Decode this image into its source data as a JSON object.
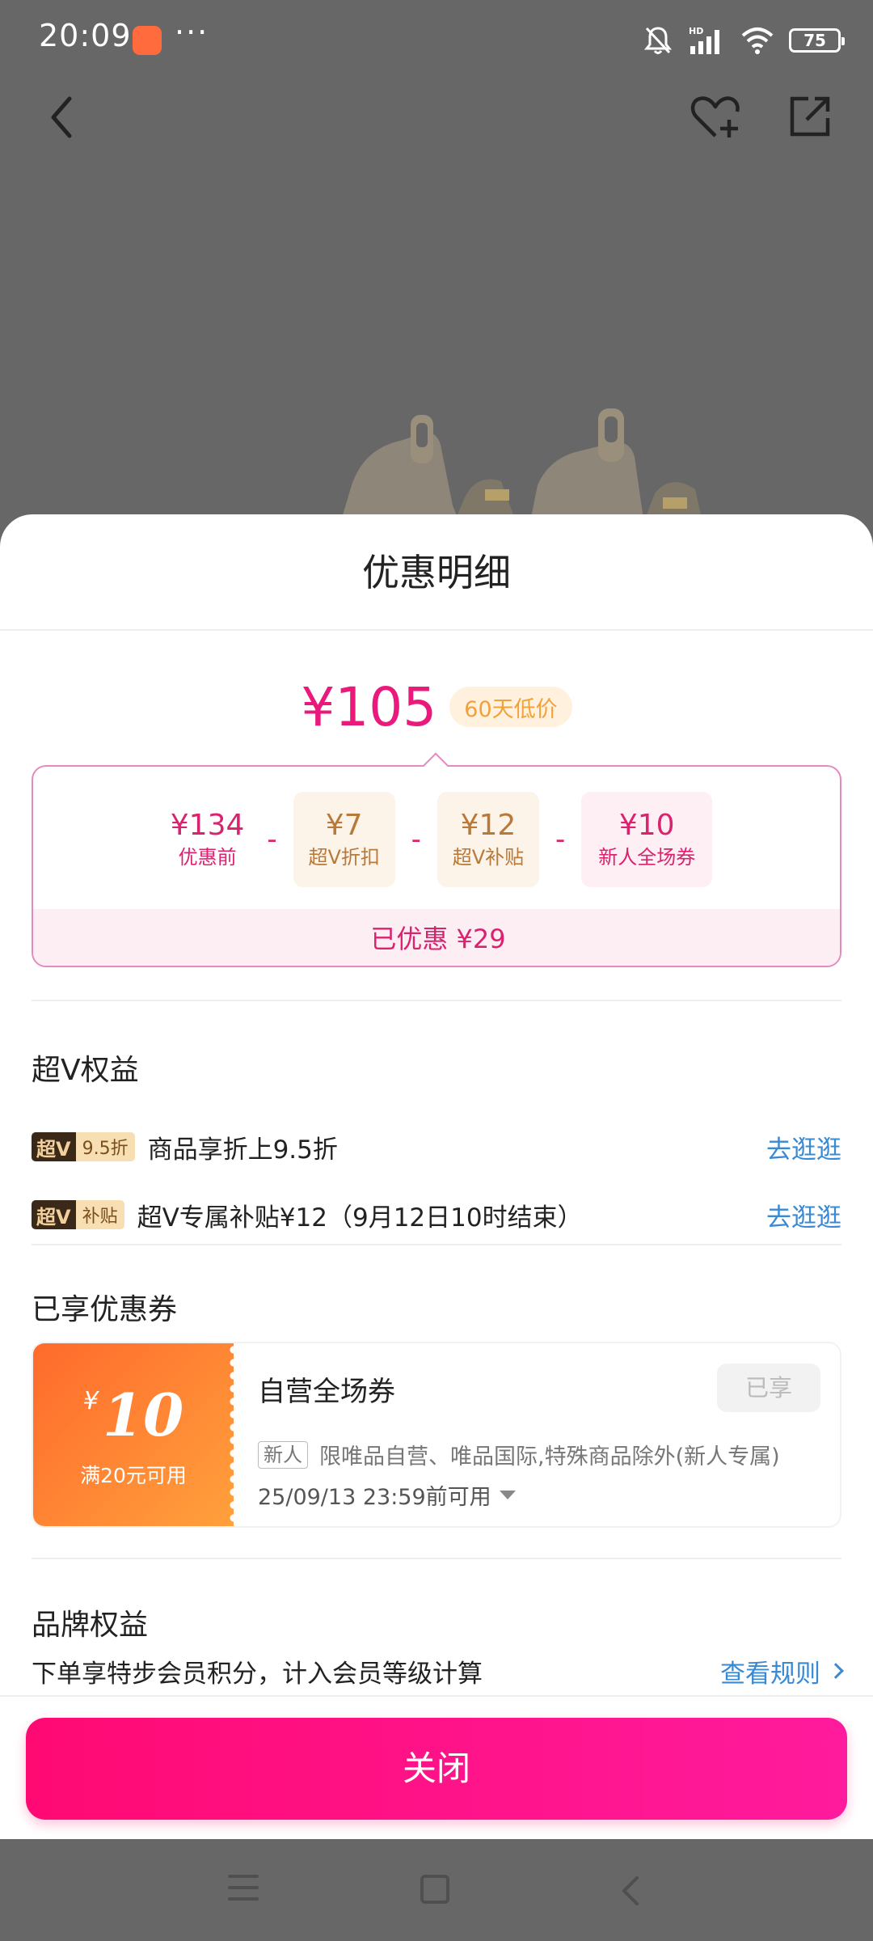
{
  "status_bar": {
    "time": "20:09",
    "app_icon": "vip-app-icon",
    "more": "···",
    "network": "HD",
    "battery": "75"
  },
  "top_bar": {
    "back_icon": "back-arrow-icon",
    "favorite_icon": "heart-plus-icon",
    "share_icon": "share-icon"
  },
  "sheet": {
    "title": "优惠明细",
    "final_price": "¥105",
    "low_price_tag": "60天低价",
    "breakdown": {
      "items": [
        {
          "amount": "¥134",
          "label": "优惠前"
        },
        {
          "amount": "¥7",
          "label": "超V折扣"
        },
        {
          "amount": "¥12",
          "label": "超V补贴"
        },
        {
          "amount": "¥10",
          "label": "新人全场券"
        }
      ],
      "minus": "-",
      "total_saved": "已优惠 ¥29"
    },
    "svip_section": {
      "title": "超V权益",
      "rows": [
        {
          "badge_main": "超V",
          "badge_sub": "9.5折",
          "text": "商品享折上9.5折",
          "link": "去逛逛"
        },
        {
          "badge_main": "超V",
          "badge_sub": "补贴",
          "text": "超V专属补贴¥12（9月12日10时结束）",
          "link": "去逛逛"
        }
      ]
    },
    "coupon_section": {
      "title": "已享优惠券",
      "coupon": {
        "currency": "¥",
        "value": "10",
        "condition": "满20元可用",
        "name": "自营全场券",
        "status": "已享",
        "tag": "新人",
        "description": "限唯品自营、唯品国际,特殊商品除外(新人专属)",
        "expiry": "25/09/13 23:59前可用"
      }
    },
    "brand_section": {
      "title": "品牌权益",
      "text": "下单享特步会员积分，计入会员等级计算",
      "link": "查看规则"
    },
    "close_button": "关闭"
  },
  "colors": {
    "accent": "#ea1a7c",
    "link": "#3a8ad3",
    "coupon_start": "#ff6a2c",
    "coupon_end": "#ffa13c",
    "overlay": "#676767"
  }
}
